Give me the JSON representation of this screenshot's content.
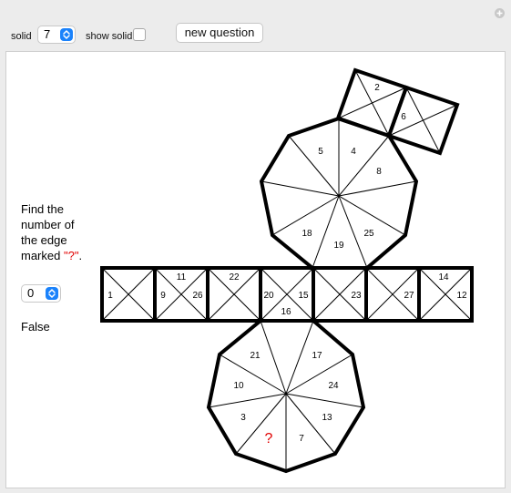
{
  "controls": {
    "solid_label": "solid",
    "solid_value": "7",
    "show_solid_label": "show solid",
    "new_question_label": "new question"
  },
  "question": {
    "line1": "Find the",
    "line2": "number of",
    "line3": "the edge",
    "line4_prefix": "marked ",
    "line4_mark": "\"?\"",
    "line4_suffix": ".",
    "answer_value": "0",
    "result": "False"
  },
  "net": {
    "top_square_labels": [
      "2",
      "6"
    ],
    "top_nonagon_labels": [
      "5",
      "4",
      "8",
      "25",
      "19",
      "18"
    ],
    "strip_labels": [
      "1",
      "9",
      "11",
      "26",
      "22",
      "20",
      "15",
      "16",
      "23",
      "27",
      "14",
      "12"
    ],
    "bottom_nonagon_labels": [
      "21",
      "17",
      "10",
      "24",
      "3",
      "13",
      "?",
      "7"
    ],
    "unknown_mark_color": "#e00000"
  }
}
